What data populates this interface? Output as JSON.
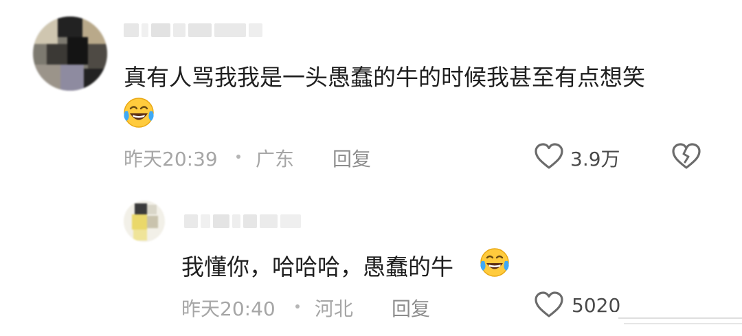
{
  "comments": [
    {
      "text": "真有人骂我我是一头愚蠢的牛的时候我甚至有点想笑",
      "emoji": "laughing-crying-emoji",
      "time": "昨天20:39",
      "location": "广东",
      "reply_label": "回复",
      "likes": "3.9万",
      "like_icon": "heart-outline-icon",
      "dislike_icon": "broken-heart-icon"
    }
  ],
  "replies": [
    {
      "text": "我懂你，哈哈哈，愚蠢的牛",
      "emoji": "laughing-crying-emoji",
      "time": "昨天20:40",
      "location": "河北",
      "reply_label": "回复",
      "likes": "5020",
      "like_icon": "heart-outline-icon"
    }
  ],
  "colors": {
    "text_primary": "#1f1f1f",
    "text_meta": "#a6a6a6",
    "icon_stroke": "#6b6b6b",
    "emoji_yellow": "#ffcb3d",
    "emoji_tears": "#3fa9f5"
  }
}
